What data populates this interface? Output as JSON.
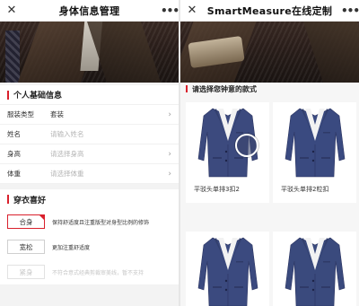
{
  "left": {
    "nav": {
      "close": "✕",
      "title": "身体信息管理",
      "more": "•••"
    },
    "basic": {
      "title": "个人基础信息",
      "rows": [
        {
          "label": "服装类型",
          "value": "套装",
          "placeholder": false
        },
        {
          "label": "姓名",
          "value": "请输入姓名",
          "placeholder": true
        },
        {
          "label": "身高",
          "value": "请选择身高",
          "placeholder": true
        },
        {
          "label": "体重",
          "value": "请选择体重",
          "placeholder": true
        }
      ]
    },
    "preference": {
      "title": "穿衣喜好",
      "options": [
        {
          "label": "合身",
          "desc": "保持舒适度且注重版型对身型比例的修饰",
          "state": "active"
        },
        {
          "label": "宽松",
          "desc": "更加注重舒适度",
          "state": "normal"
        },
        {
          "label": "紧身",
          "desc": "不符合意式经典剪裁审美线，暂不支持",
          "state": "disabled"
        }
      ]
    }
  },
  "right": {
    "nav": {
      "close": "✕",
      "title": "SmartMeasure在线定制",
      "more": "•••"
    },
    "prompt": "请选择您钟意的款式",
    "styles": [
      {
        "label": "平驳头单排3扣2",
        "jacket_color": "#3c4a7e",
        "zoom": true
      },
      {
        "label": "平驳头单排2粒扣",
        "jacket_color": "#3a4a80",
        "zoom": false
      },
      {
        "label": "",
        "jacket_color": "#3b4a7f",
        "zoom": false
      },
      {
        "label": "",
        "jacket_color": "#3a4a7d",
        "zoom": false
      }
    ]
  },
  "colors": {
    "accent": "#d9202c",
    "navy": "#3c4a7e"
  },
  "icons": {
    "close": "close-icon",
    "more": "more-icon",
    "chevron": "chevron-right-icon"
  }
}
